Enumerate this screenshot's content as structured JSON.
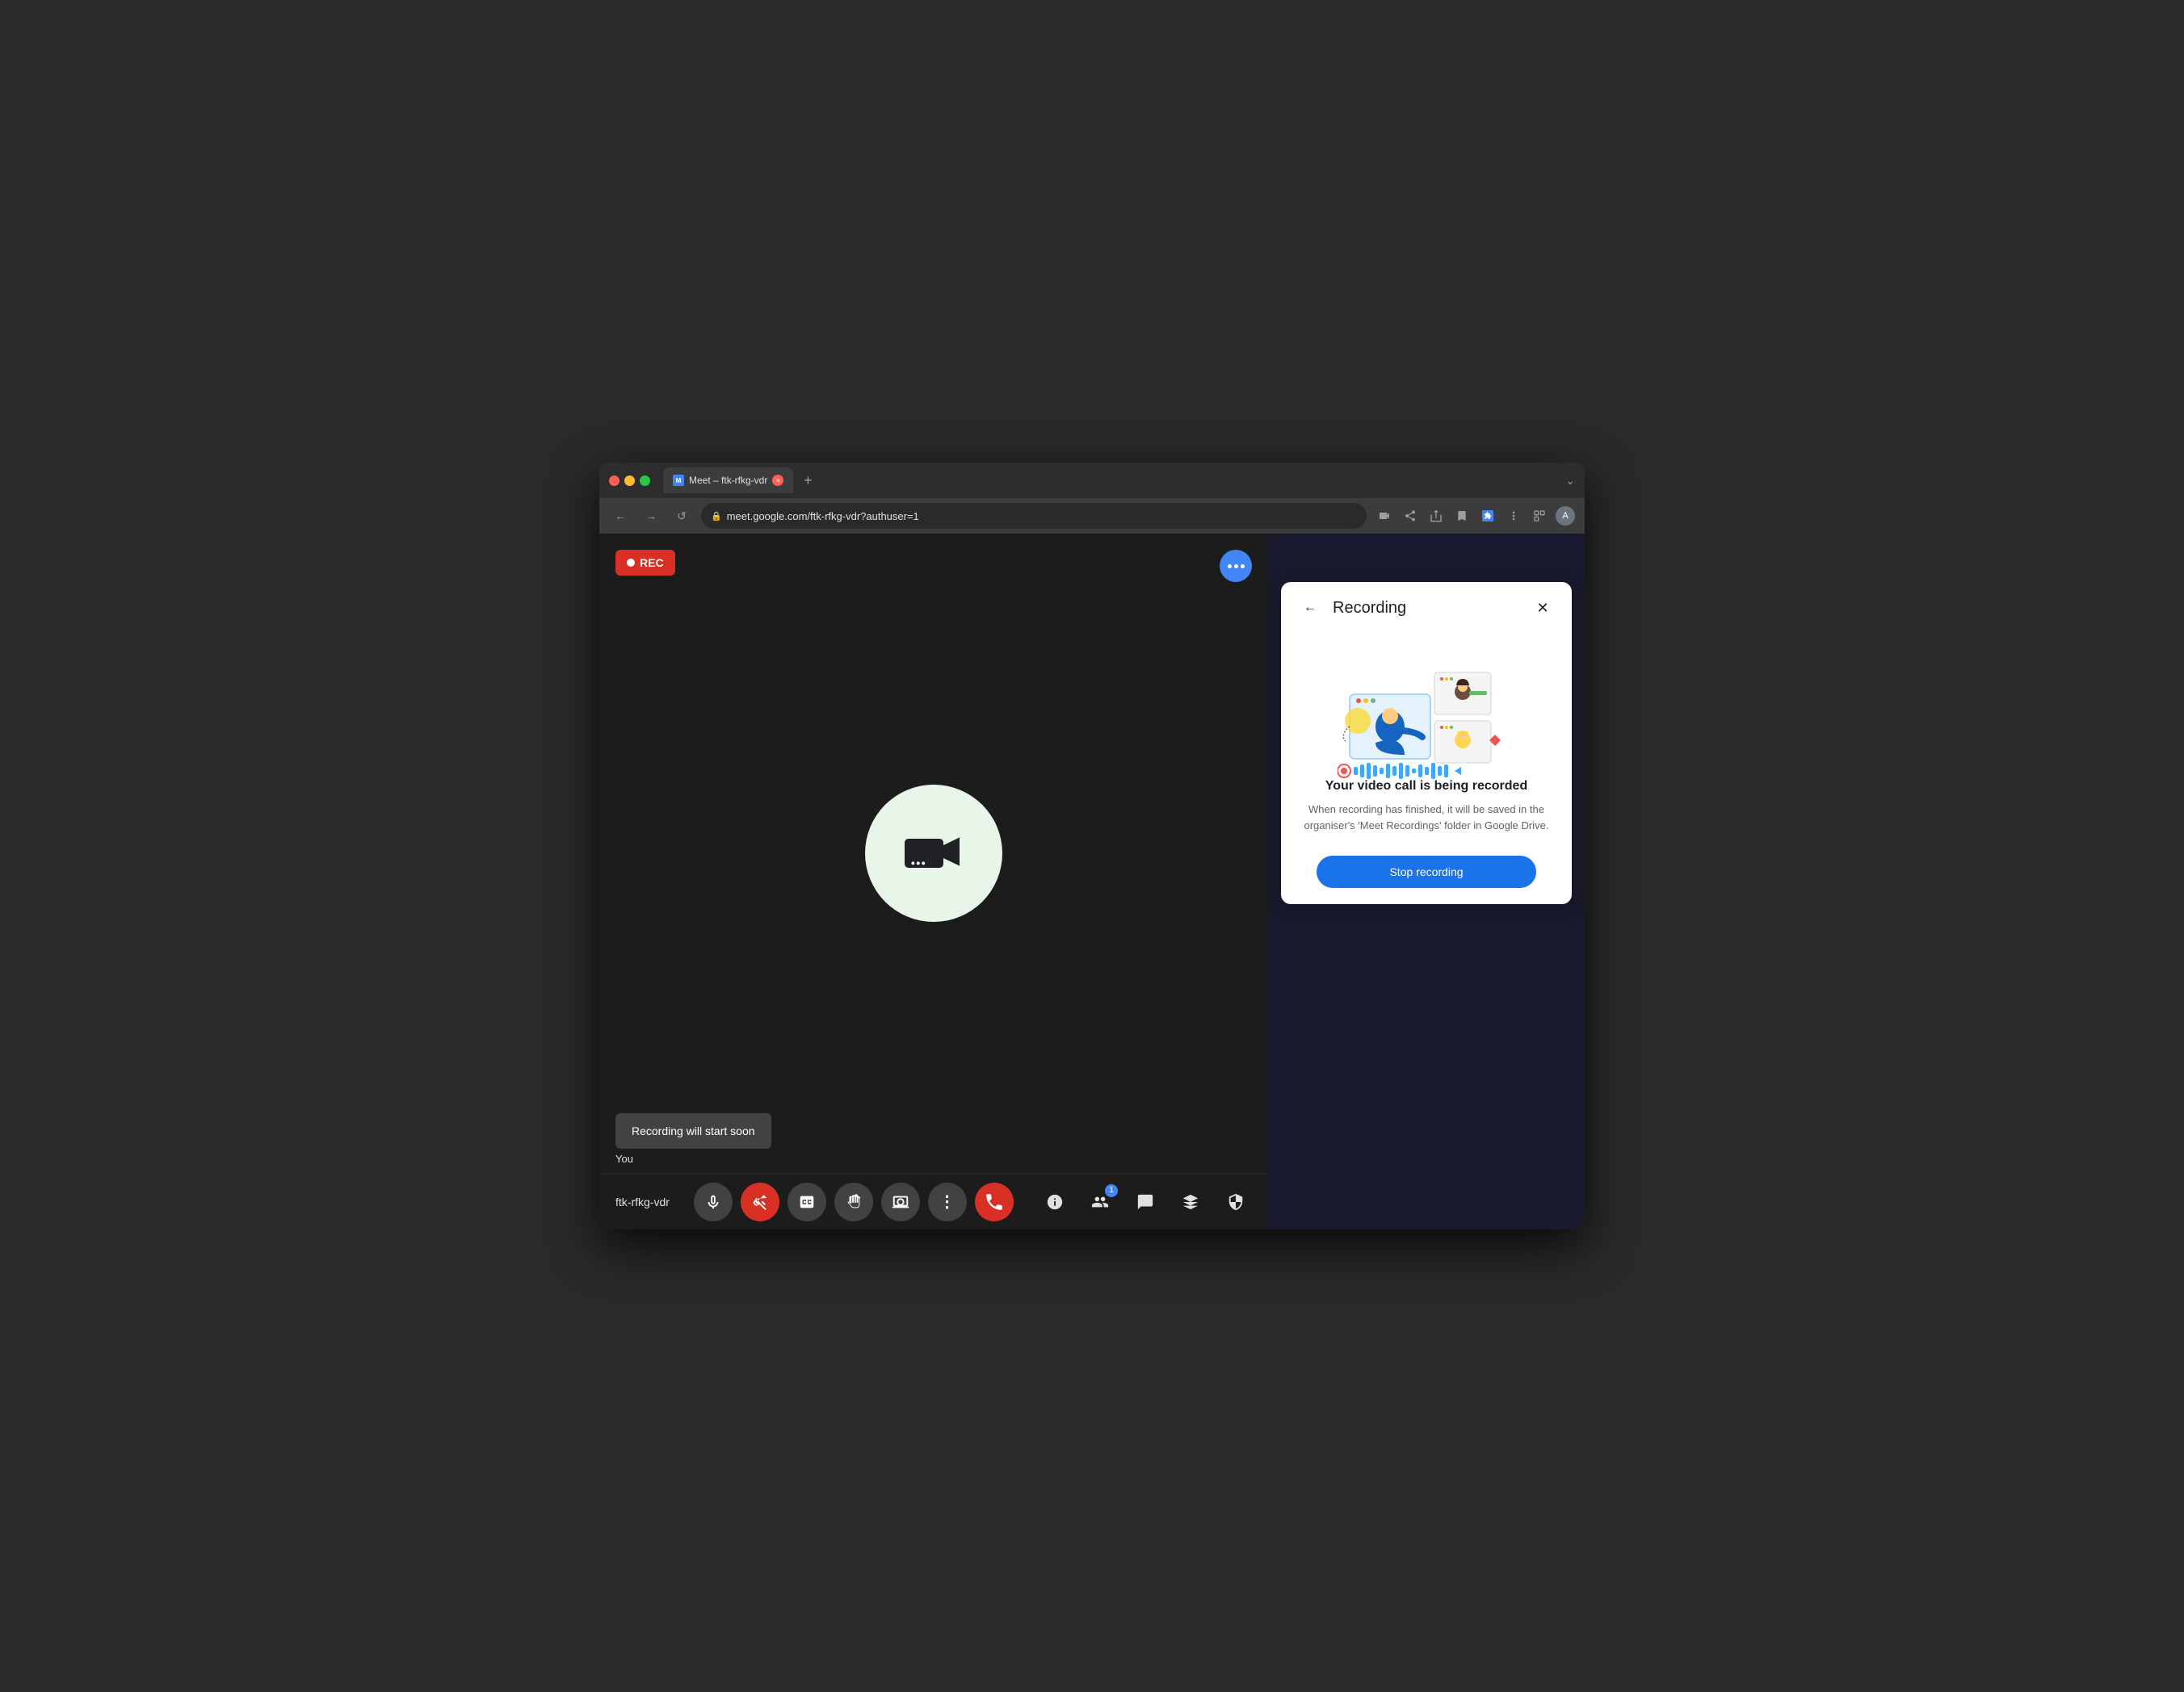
{
  "browser": {
    "tab_title": "Meet – ftk-rfkg-vdr",
    "tab_favicon": "M",
    "url": "meet.google.com/ftk-rfkg-vdr?authuser=1",
    "new_tab_icon": "+",
    "collapse_icon": "⌄"
  },
  "nav": {
    "back_icon": "←",
    "forward_icon": "→",
    "refresh_icon": "↺",
    "lock_icon": "🔒"
  },
  "meet": {
    "rec_label": "REC",
    "meeting_name": "ftk-rfkg-vdr",
    "notification": "Recording will start soon",
    "you_label": "You"
  },
  "toolbar": {
    "mic_icon": "🎤",
    "camera_off_icon": "📵",
    "captions_icon": "CC",
    "hand_icon": "✋",
    "present_icon": "⬆",
    "more_icon": "⋮",
    "end_call_icon": "📵",
    "info_icon": "ℹ",
    "people_icon": "👥",
    "chat_icon": "💬",
    "activities_icon": "⬡",
    "lock_icon": "🔒",
    "people_badge": "1"
  },
  "recording_panel": {
    "title": "Recording",
    "heading": "Your video call is being recorded",
    "subtext": "When recording has finished, it will be saved in the organiser's 'Meet Recordings' folder in Google Drive.",
    "stop_button": "Stop recording",
    "back_icon": "←",
    "close_icon": "✕"
  },
  "colors": {
    "brand_blue": "#1a73e8",
    "rec_red": "#d93025",
    "dark_bg": "#1c1c1c",
    "panel_bg": "#ffffff",
    "text_primary": "#202124",
    "text_secondary": "#5f6368"
  }
}
